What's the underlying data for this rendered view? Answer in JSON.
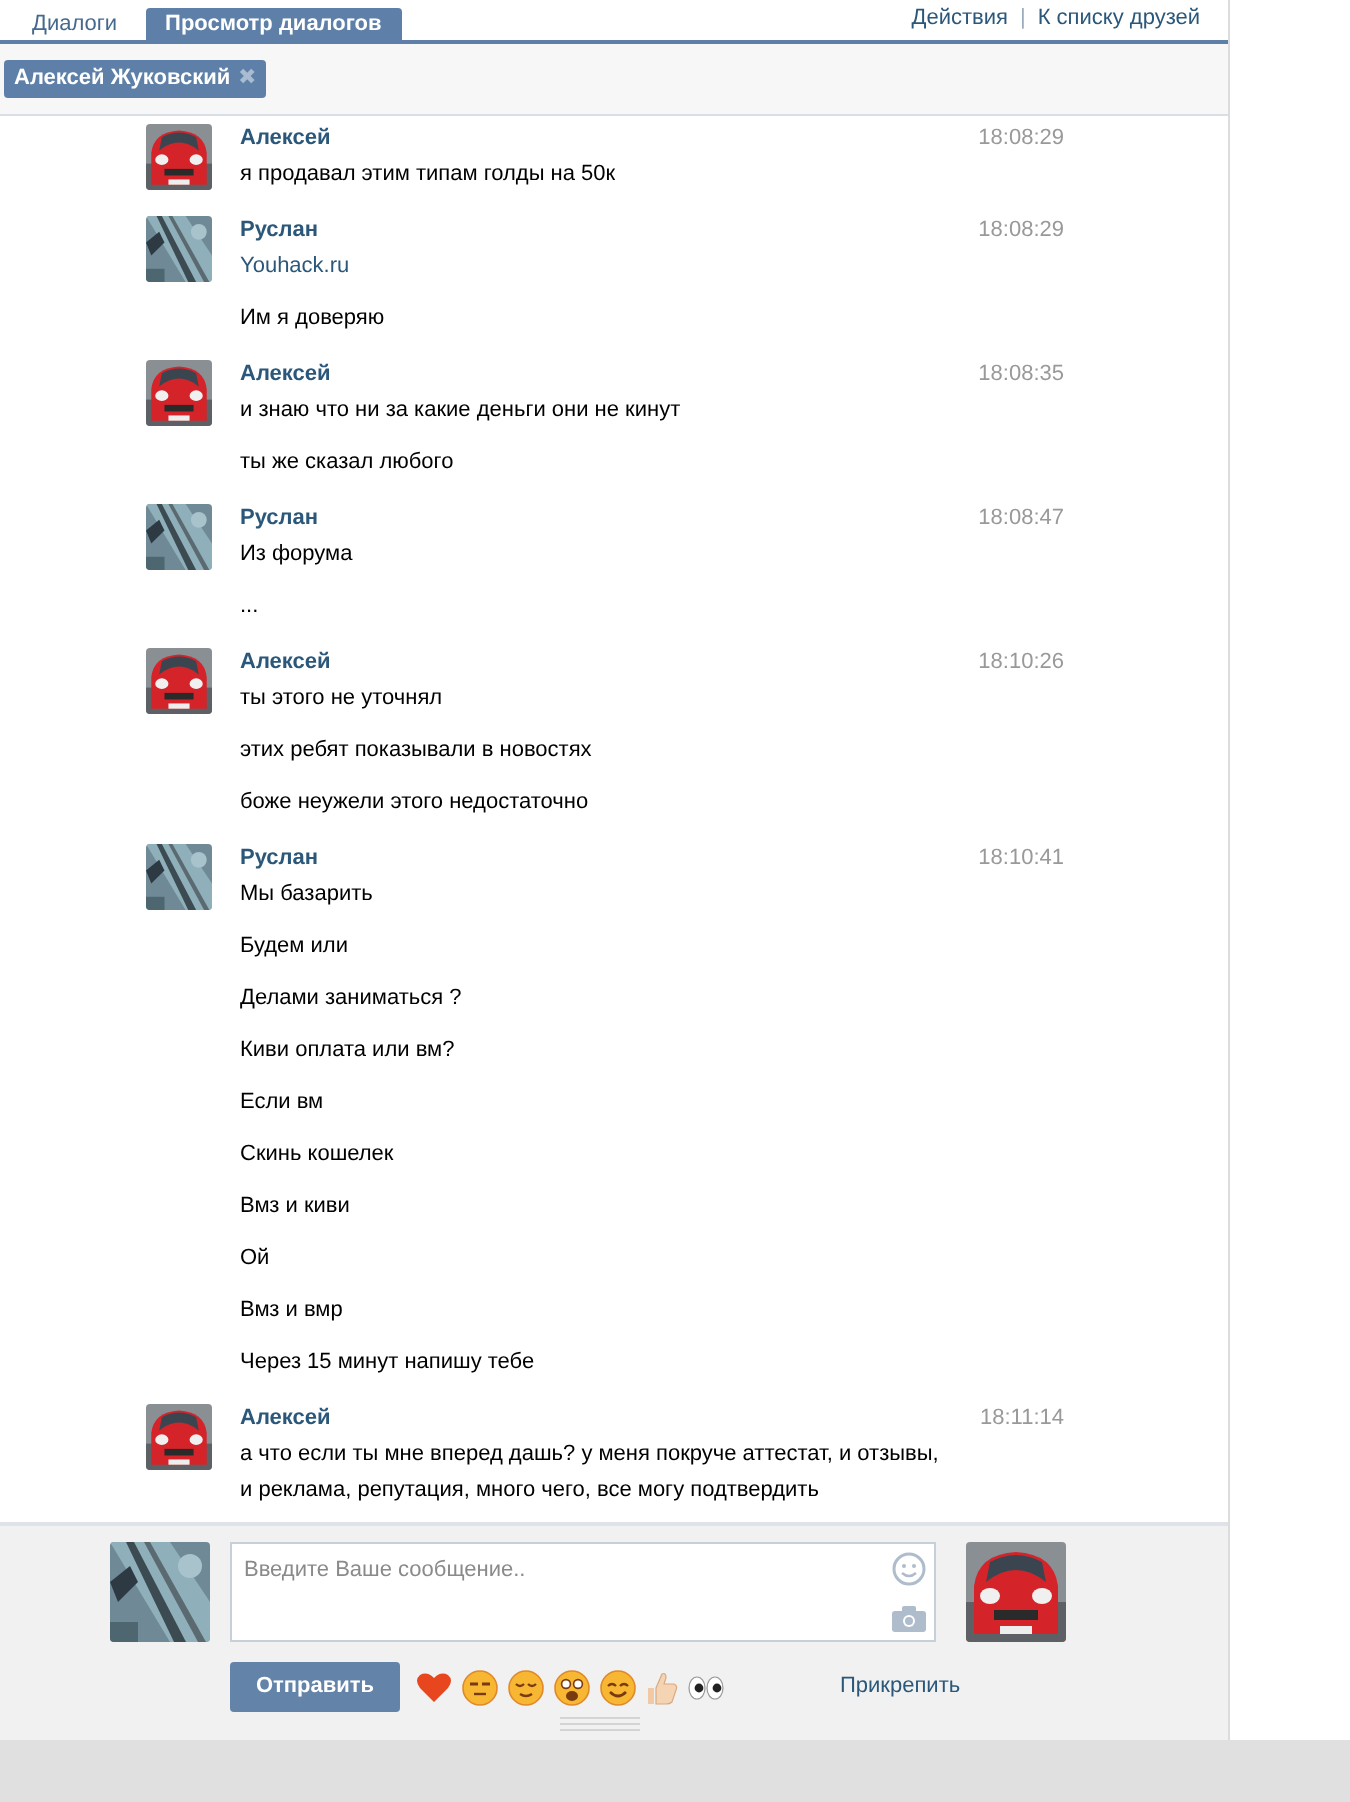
{
  "tabs": [
    {
      "label": "Диалоги",
      "selected": false
    },
    {
      "label": "Просмотр диалогов",
      "selected": true
    }
  ],
  "links": [
    {
      "label": "Действия"
    },
    {
      "label": "К списку друзей"
    }
  ],
  "link_separator": "|",
  "recipient": {
    "name": "Алексей Жуковский",
    "close": "✖"
  },
  "messages": [
    {
      "author": "Алексей",
      "time": "18:08:29",
      "lines": [
        {
          "kind": "text",
          "text": "я продавал этим типам голды на 50к"
        }
      ]
    },
    {
      "author": "Руслан",
      "time": "18:08:29",
      "lines": [
        {
          "kind": "link",
          "text": "Youhack.ru"
        },
        {
          "kind": "text",
          "text": "Им я доверяю"
        }
      ]
    },
    {
      "author": "Алексей",
      "time": "18:08:35",
      "lines": [
        {
          "kind": "text",
          "text": "и знаю что ни за какие деньги они не кинут"
        },
        {
          "kind": "text",
          "text": "ты же сказал любого"
        }
      ]
    },
    {
      "author": "Руслан",
      "time": "18:08:47",
      "lines": [
        {
          "kind": "text",
          "text": "Из форума"
        },
        {
          "kind": "text",
          "text": "..."
        }
      ]
    },
    {
      "author": "Алексей",
      "time": "18:10:26",
      "lines": [
        {
          "kind": "text",
          "text": "ты этого не уточнял"
        },
        {
          "kind": "text",
          "text": "этих ребят показывали в новостях"
        },
        {
          "kind": "text",
          "text": "боже неужели этого недостаточно"
        }
      ]
    },
    {
      "author": "Руслан",
      "time": "18:10:41",
      "lines": [
        {
          "kind": "text",
          "text": "Мы базарить"
        },
        {
          "kind": "text",
          "text": "Будем или"
        },
        {
          "kind": "text",
          "text": "Делами заниматься ?"
        },
        {
          "kind": "text",
          "text": "Киви оплата или вм?"
        },
        {
          "kind": "text",
          "text": "Если вм"
        },
        {
          "kind": "text",
          "text": "Скинь кошелек"
        },
        {
          "kind": "text",
          "text": "Вмз и киви"
        },
        {
          "kind": "text",
          "text": "Ой"
        },
        {
          "kind": "text",
          "text": "Вмз и вмр"
        },
        {
          "kind": "text",
          "text": "Через 15 минут напишу тебе"
        }
      ]
    },
    {
      "author": "Алексей",
      "time": "18:11:14",
      "lines": [
        {
          "kind": "text",
          "text": "а что если ты мне вперед дашь? у меня покруче аттестат, и отзывы,\nи реклама, репутация, много чего, все могу подтвердить"
        }
      ]
    }
  ],
  "composer": {
    "placeholder": "Введите Ваше сообщение..",
    "send": "Отправить",
    "attach": "Прикрепить"
  }
}
